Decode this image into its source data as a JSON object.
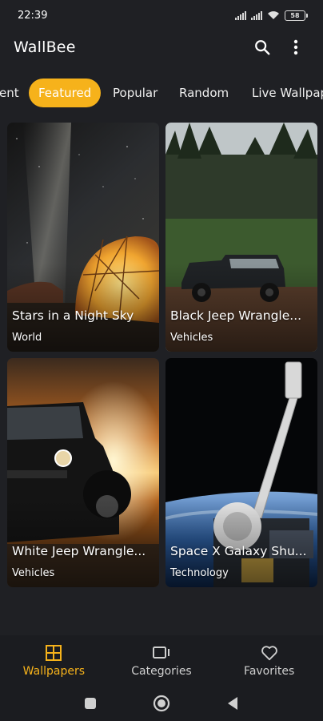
{
  "status_bar": {
    "time": "22:39",
    "battery": "58"
  },
  "app": {
    "title": "WallBee"
  },
  "tabs": [
    "ent",
    "Featured",
    "Popular",
    "Random",
    "Live Wallpap"
  ],
  "active_tab": "Featured",
  "wallpapers": [
    {
      "title": "Stars in a Night Sky",
      "category": "World"
    },
    {
      "title": "Black Jeep Wrangle...",
      "category": "Vehicles"
    },
    {
      "title": "White Jeep Wrangle...",
      "category": "Vehicles"
    },
    {
      "title": "Space X Galaxy Shu...",
      "category": "Technology"
    }
  ],
  "bottom_nav": [
    {
      "label": "Wallpapers",
      "icon": "grid-icon",
      "active": true
    },
    {
      "label": "Categories",
      "icon": "categories-icon",
      "active": false
    },
    {
      "label": "Favorites",
      "icon": "heart-icon",
      "active": false
    }
  ],
  "colors": {
    "accent": "#f6b21b",
    "background": "#1f2024"
  }
}
